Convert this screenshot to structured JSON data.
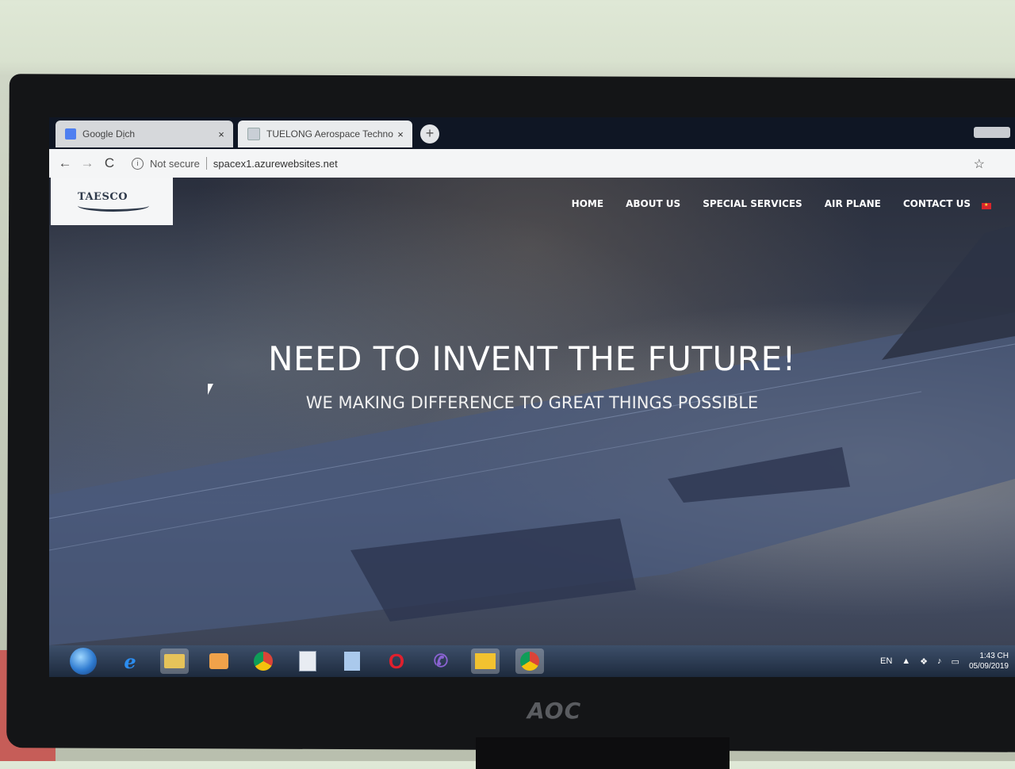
{
  "monitor": {
    "brand": "AOC"
  },
  "browser": {
    "tabs": [
      {
        "title": "Google Dịch",
        "close": "×",
        "active": false
      },
      {
        "title": "TUELONG Aerospace Technology",
        "close": "×",
        "active": true
      }
    ],
    "new_tab": "+",
    "back": "←",
    "forward": "→",
    "reload": "C",
    "security_label": "Not secure",
    "url": "spacex1.azurewebsites.net",
    "bookmark": "☆"
  },
  "site": {
    "logo_text": "TAESCO",
    "nav": [
      "HOME",
      "ABOUT US",
      "SPECIAL SERVICES",
      "AIR PLANE",
      "CONTACT US"
    ],
    "hero_title": "NEED TO INVENT THE FUTURE!",
    "hero_subtitle": "WE MAKING DIFFERENCE TO GREAT THINGS POSSIBLE"
  },
  "taskbar": {
    "icons": [
      "start-orb",
      "internet-explorer",
      "file-explorer",
      "media-player",
      "chrome",
      "document",
      "spreadsheet",
      "opera",
      "viber",
      "outlook",
      "chrome-active"
    ],
    "language": "EN",
    "time": "1:43 CH",
    "date": "05/09/2019"
  }
}
